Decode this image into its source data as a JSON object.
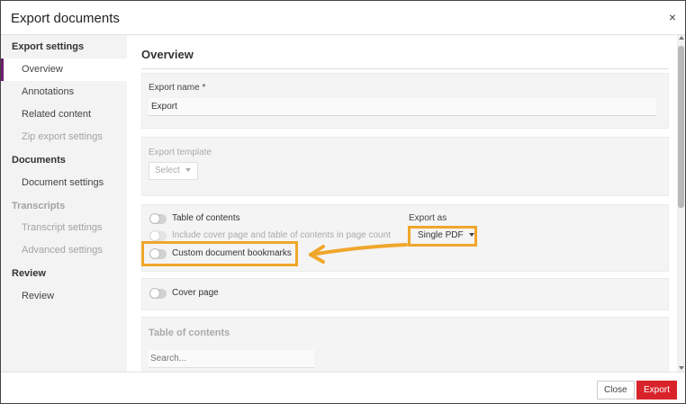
{
  "dialog": {
    "title": "Export documents",
    "close_symbol": "×"
  },
  "sidebar": {
    "groups": [
      {
        "label": "Export settings",
        "muted": false
      },
      {
        "label": "Documents",
        "muted": false
      },
      {
        "label": "Transcripts",
        "muted": true
      },
      {
        "label": "Review",
        "muted": false
      }
    ],
    "items": [
      {
        "label": "Overview",
        "active": true,
        "muted": false
      },
      {
        "label": "Annotations",
        "active": false,
        "muted": false
      },
      {
        "label": "Related content",
        "active": false,
        "muted": false
      },
      {
        "label": "Zip export settings",
        "active": false,
        "muted": true
      },
      {
        "label": "Document settings",
        "active": false,
        "muted": false
      },
      {
        "label": "Transcript settings",
        "active": false,
        "muted": true
      },
      {
        "label": "Advanced settings",
        "active": false,
        "muted": true
      },
      {
        "label": "Review",
        "active": false,
        "muted": false
      }
    ]
  },
  "main": {
    "title": "Overview",
    "export_name": {
      "label": "Export name *",
      "value": "Export"
    },
    "export_template": {
      "label": "Export template",
      "select_value": "Select"
    },
    "toggles": {
      "table_of_contents": {
        "label": "Table of contents",
        "on": false
      },
      "include_cover_page": {
        "label": "Include cover page and table of contents in page count",
        "on": false,
        "disabled": true
      },
      "custom_bookmarks": {
        "label": "Custom document bookmarks",
        "on": false
      },
      "cover_page": {
        "label": "Cover page",
        "on": false
      }
    },
    "export_as": {
      "label": "Export as",
      "value": "Single PDF"
    },
    "toc_section": {
      "title": "Table of contents",
      "search_placeholder": "Search..."
    }
  },
  "footer": {
    "close_label": "Close",
    "export_label": "Export"
  },
  "colors": {
    "accent_active": "#6b1d6b",
    "highlight": "#f0a62b",
    "export_button": "#d8232a"
  }
}
